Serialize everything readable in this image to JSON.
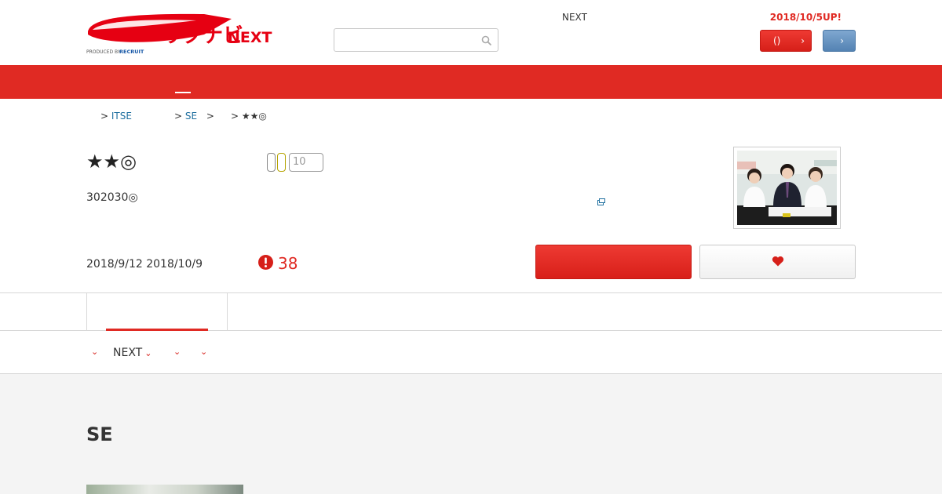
{
  "header": {
    "logo_text": "リクナビNEXT",
    "logo_sub": "PRODUCED BY RECRUIT",
    "search_placeholder": "",
    "next_link": "NEXT",
    "promo": "2018/10/5UP!",
    "btn_red_label": "()",
    "btn_red_chevron": "›",
    "btn_blue_chevron": "›",
    "colors": {
      "brand_red": "#e02a23",
      "blue": "#5483b3"
    }
  },
  "breadcrumb": {
    "items": [
      {
        "prefix": ">",
        "label": "ITSE"
      },
      {
        "prefix": ">",
        "label": "SE",
        "suffix": ">"
      },
      {
        "prefix": ">",
        "label": "★★◎"
      }
    ]
  },
  "job": {
    "company": "★★◎",
    "count_placeholder": "10",
    "subtitle": "302030◎",
    "dates": "2018/9/12 2018/10/9",
    "days_left": "38",
    "icons": [
      "external-link-icon",
      "alert-icon",
      "heart-icon"
    ]
  },
  "subnav": {
    "items": [
      {
        "label": ""
      },
      {
        "label": "NEXT"
      },
      {
        "label": ""
      },
      {
        "label": ""
      }
    ],
    "chevron": "⌄"
  },
  "section": {
    "title": "SE"
  }
}
